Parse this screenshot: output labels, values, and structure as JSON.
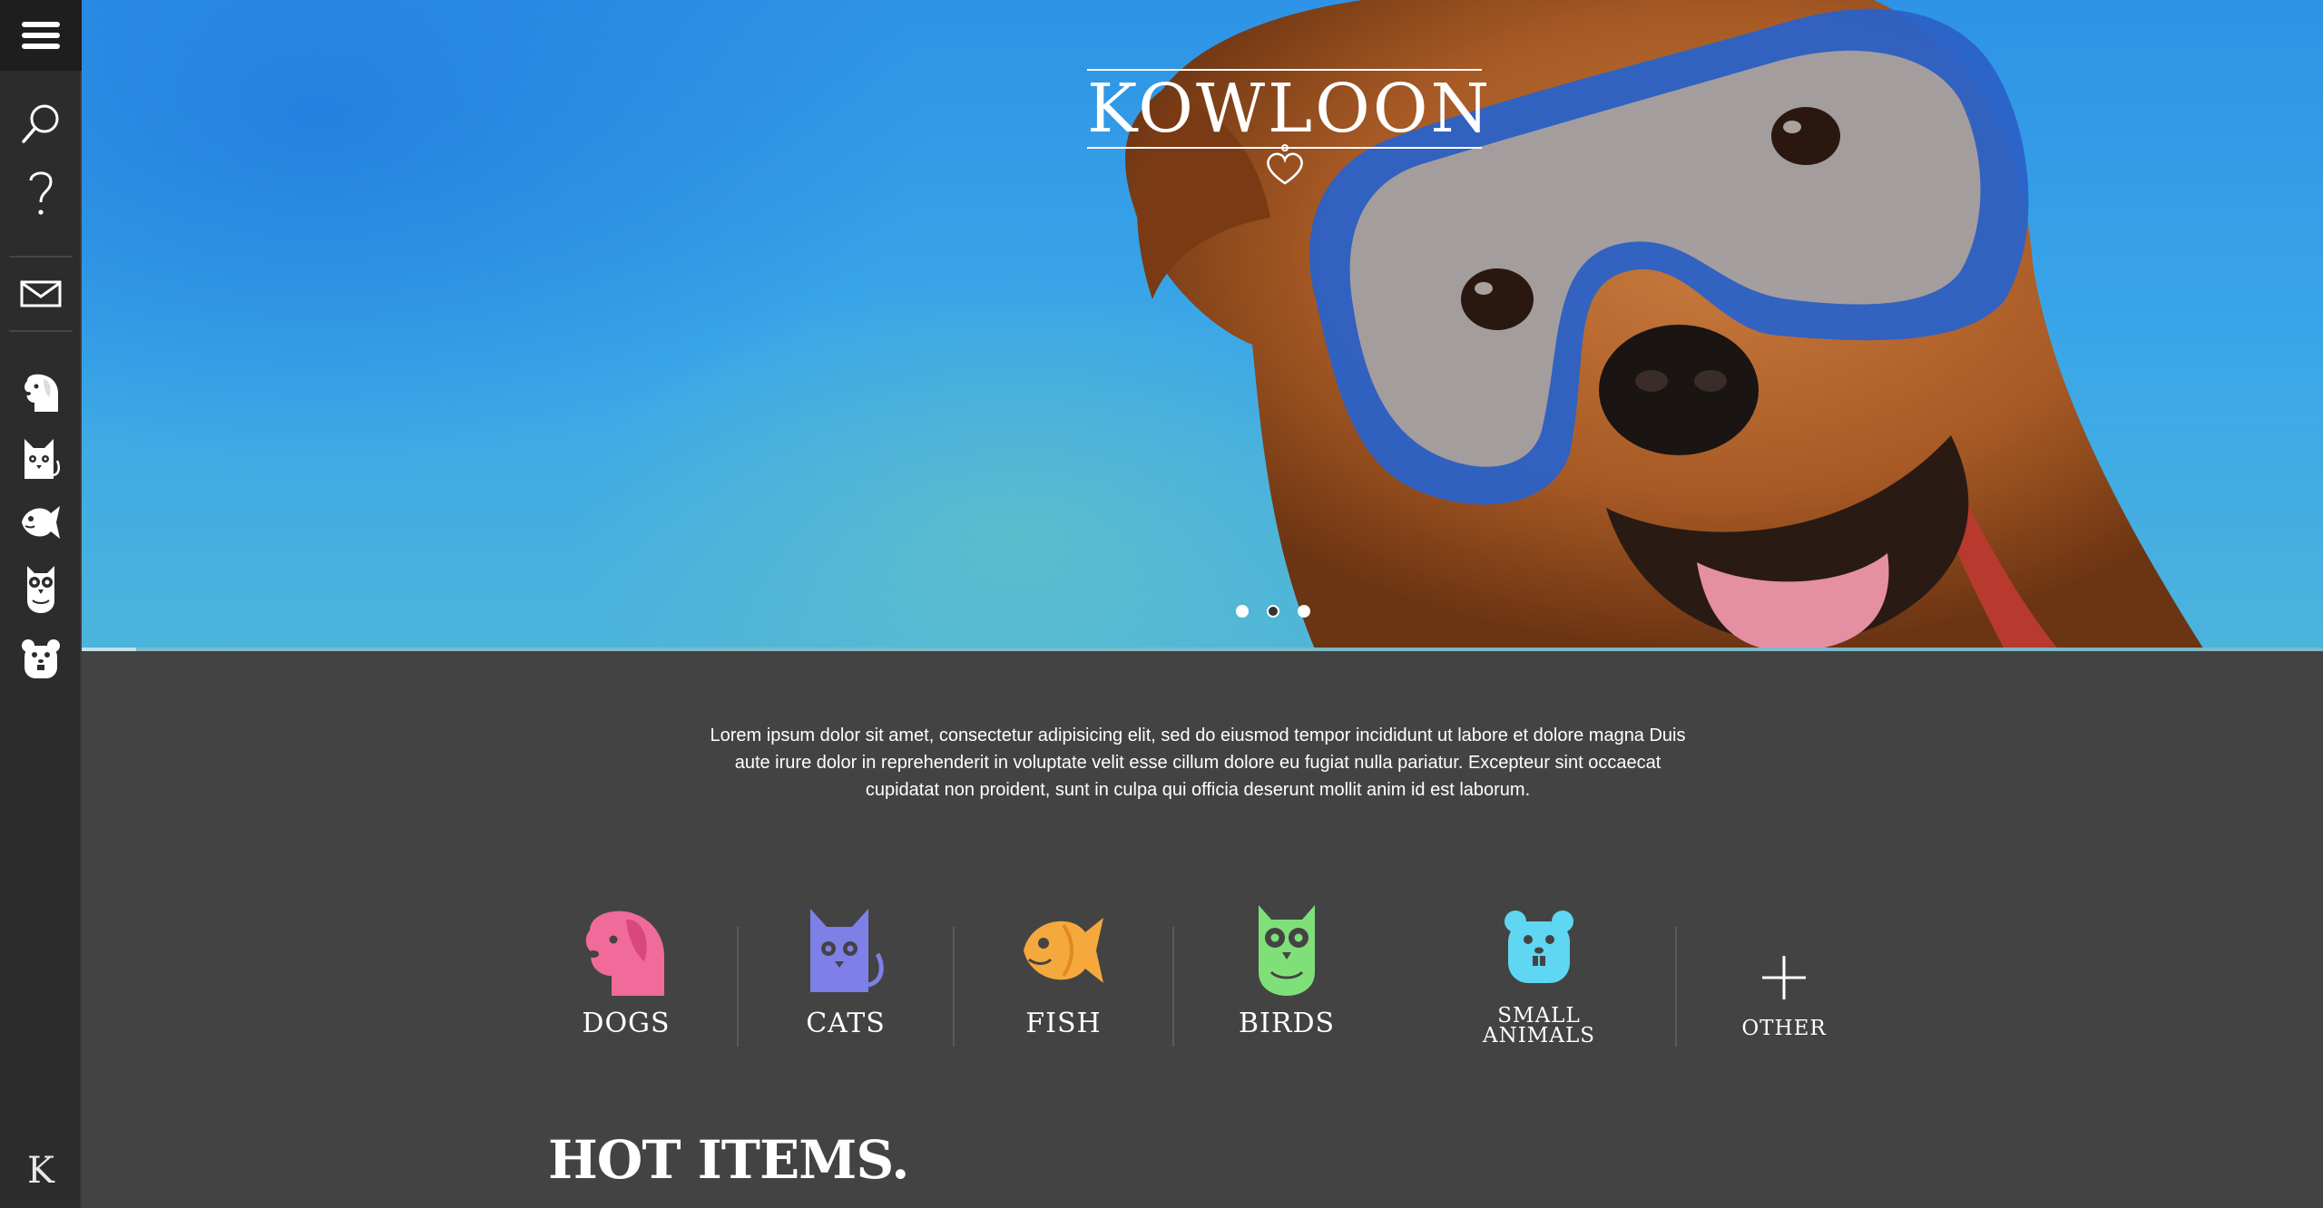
{
  "sidebar": {
    "menu_icon": "hamburger-menu-icon",
    "items": [
      {
        "name": "search",
        "icon": "search-icon"
      },
      {
        "name": "help",
        "icon": "question-mark-icon"
      },
      {
        "name": "mail",
        "icon": "envelope-icon"
      },
      {
        "name": "dogs",
        "icon": "dog-icon"
      },
      {
        "name": "cats",
        "icon": "cat-icon"
      },
      {
        "name": "fish",
        "icon": "fish-icon"
      },
      {
        "name": "birds",
        "icon": "owl-icon"
      },
      {
        "name": "small-animals",
        "icon": "hamster-icon"
      }
    ],
    "logo": "K"
  },
  "hero": {
    "brand": "KOWLOON",
    "slides": {
      "count": 3,
      "active_index": 1
    },
    "colors": {
      "sky": "#3aa7e8",
      "accent": "#7fb8c7"
    }
  },
  "intro": {
    "text": "Lorem ipsum dolor sit amet, consectetur adipisicing elit, sed do eiusmod tempor incididunt ut labore et dolore magna Duis aute irure dolor in reprehenderit in voluptate velit esse cillum dolore eu fugiat nulla pariatur. Excepteur sint occaecat cupidatat non proident, sunt in culpa qui officia deserunt mollit anim id est laborum."
  },
  "categories": [
    {
      "label": "DOGS",
      "icon": "dog-icon",
      "color": "#f06a9a"
    },
    {
      "label": "CATS",
      "icon": "cat-icon",
      "color": "#7f7fe8"
    },
    {
      "label": "FISH",
      "icon": "fish-icon",
      "color": "#f5a83c"
    },
    {
      "label": "BIRDS",
      "icon": "owl-icon",
      "color": "#7fe07a"
    },
    {
      "label_line1": "SMALL",
      "label_line2": "ANIMALS",
      "icon": "hamster-icon",
      "color": "#5fd6f2"
    },
    {
      "label": "OTHER",
      "icon": "plus-icon",
      "color": "#ffffff"
    }
  ],
  "section": {
    "title": "HOT ITEMS."
  }
}
